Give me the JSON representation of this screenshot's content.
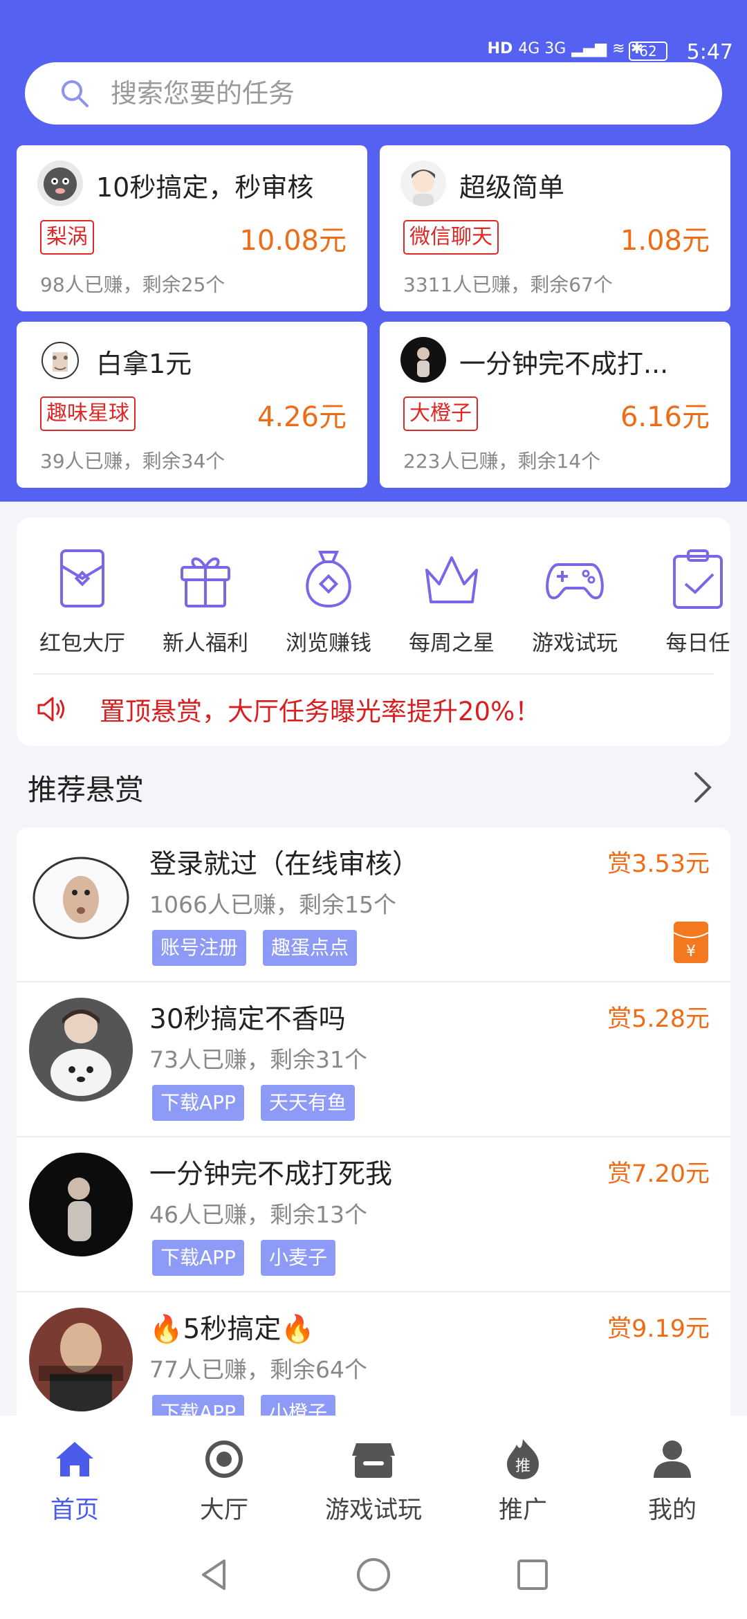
{
  "status_bar": {
    "network": "4G 3G",
    "battery": "62",
    "time": "5:47"
  },
  "search": {
    "placeholder": "搜索您要的任务"
  },
  "featured": [
    {
      "title": "10秒搞定，秒审核",
      "tag": "梨涡",
      "price": "10.08元",
      "stats": "98人已赚，剩余25个"
    },
    {
      "title": "超级简单",
      "tag": "微信聊天",
      "price": "1.08元",
      "stats": "3311人已赚，剩余67个"
    },
    {
      "title": "白拿1元",
      "tag": "趣味星球",
      "price": "4.26元",
      "stats": "39人已赚，剩余34个"
    },
    {
      "title": "一分钟完不成打...",
      "tag": "大橙子",
      "price": "6.16元",
      "stats": "223人已赚，剩余14个"
    }
  ],
  "categories": [
    {
      "label": "红包大厅",
      "icon": "red-envelope-icon"
    },
    {
      "label": "新人福利",
      "icon": "gift-icon"
    },
    {
      "label": "浏览赚钱",
      "icon": "money-bag-icon"
    },
    {
      "label": "每周之星",
      "icon": "crown-icon"
    },
    {
      "label": "游戏试玩",
      "icon": "gamepad-icon"
    },
    {
      "label": "每日任",
      "icon": "clipboard-check-icon"
    }
  ],
  "notice": {
    "text": "置顶悬赏，大厅任务曝光率提升20%！"
  },
  "section": {
    "title": "推荐悬赏"
  },
  "tasks": [
    {
      "title": "登录就过（在线审核）",
      "stats": "1066人已赚，剩余15个",
      "tags": [
        "账号注册",
        "趣蛋点点"
      ],
      "reward": "赏3.53元",
      "has_redpacket": true
    },
    {
      "title": "30秒搞定不香吗",
      "stats": "73人已赚，剩余31个",
      "tags": [
        "下载APP",
        "天天有鱼"
      ],
      "reward": "赏5.28元"
    },
    {
      "title": "一分钟完不成打死我",
      "stats": "46人已赚，剩余13个",
      "tags": [
        "下载APP",
        "小麦子"
      ],
      "reward": "赏7.20元"
    },
    {
      "title": "🔥5秒搞定🔥",
      "stats": "77人已赚，剩余64个",
      "tags": [
        "下载APP",
        "小橙子"
      ],
      "reward": "赏9.19元"
    }
  ],
  "bottom_nav": [
    {
      "label": "首页",
      "icon": "home-icon",
      "active": true
    },
    {
      "label": "大厅",
      "icon": "hall-icon"
    },
    {
      "label": "游戏试玩",
      "icon": "game-store-icon"
    },
    {
      "label": "推广",
      "icon": "promote-icon"
    },
    {
      "label": "我的",
      "icon": "profile-icon"
    }
  ],
  "colors": {
    "brand": "#5561f0",
    "price": "#ee6c16",
    "alert": "#d81f1f",
    "tag_bg": "#8d9bf6",
    "icon_purple": "#7a67e8"
  }
}
